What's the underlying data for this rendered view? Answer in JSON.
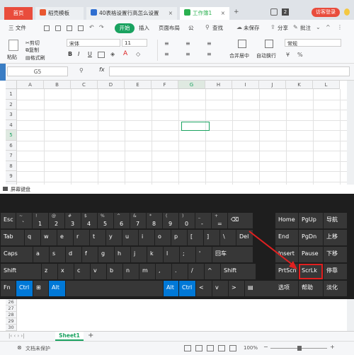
{
  "tabs": {
    "home": "首页",
    "template": "稻壳模板",
    "doc": "40表格设置行高怎么设置",
    "workbook": "工作簿1",
    "badge": "2",
    "login": "访客登录"
  },
  "menubar": {
    "file": "三 文件",
    "start": "开始",
    "insert": "插入",
    "layout": "页面布局",
    "formula": "公",
    "search": "查找",
    "unsaved": "未保存",
    "share": "分享",
    "annotate": "批注"
  },
  "ribbon": {
    "cut": "剪切",
    "copy": "复制",
    "format_painter": "格式刷",
    "paste": "粘贴",
    "font_name": "宋体",
    "font_size": "11",
    "number_format": "常规",
    "merge_center": "合并居中",
    "auto_wrap": "自动换行",
    "bold": "B",
    "italic": "I",
    "underline": "U",
    "font_color": "A"
  },
  "formula_bar": {
    "cell_ref": "G5",
    "fx": "fx",
    "content": ""
  },
  "sheet": {
    "columns": [
      "A",
      "B",
      "C",
      "D",
      "E",
      "F",
      "G",
      "H",
      "I",
      "J",
      "K",
      "L"
    ],
    "rows": [
      "1",
      "2",
      "3",
      "4",
      "5",
      "6",
      "7",
      "8",
      "9",
      "10"
    ],
    "lower_rows": [
      "26",
      "27",
      "28",
      "29",
      "30"
    ],
    "selected_cell": "G5"
  },
  "osk": {
    "title": "屏幕键盘",
    "row1": [
      {
        "label": "Esc"
      },
      {
        "shift": "~",
        "label": "`"
      },
      {
        "shift": "!",
        "label": "1"
      },
      {
        "shift": "@",
        "label": "2"
      },
      {
        "shift": "#",
        "label": "3"
      },
      {
        "shift": "$",
        "label": "4"
      },
      {
        "shift": "%",
        "label": "5"
      },
      {
        "shift": "^",
        "label": "6"
      },
      {
        "shift": "&",
        "label": "7"
      },
      {
        "shift": "*",
        "label": "8"
      },
      {
        "shift": "(",
        "label": "9"
      },
      {
        "shift": ")",
        "label": "0"
      },
      {
        "shift": "_",
        "label": "-"
      },
      {
        "shift": "+",
        "label": "="
      },
      {
        "label": "⌫"
      }
    ],
    "row2": [
      "Tab",
      "q",
      "w",
      "e",
      "r",
      "t",
      "y",
      "u",
      "i",
      "o",
      "p",
      "[",
      "]",
      "\\",
      "Del"
    ],
    "row3": [
      "Caps",
      "a",
      "s",
      "d",
      "f",
      "g",
      "h",
      "j",
      "k",
      "l",
      ";",
      "'",
      "回车"
    ],
    "row4": [
      "Shift",
      "z",
      "x",
      "c",
      "v",
      "b",
      "n",
      "m",
      ",",
      ".",
      "/",
      "^",
      "Shift"
    ],
    "row5": [
      "Fn",
      "Ctrl",
      "⊞",
      "Alt",
      "",
      "Alt",
      "Ctrl",
      "<",
      "v",
      ">",
      "▤"
    ],
    "nav": [
      [
        "Home",
        "PgUp",
        "导航"
      ],
      [
        "End",
        "PgDn",
        "上移"
      ],
      [
        "Insert",
        "Pause",
        "下移"
      ],
      [
        "PrtScn",
        "ScrLk",
        "停靠"
      ],
      [
        "选项",
        "帮助",
        "淡化"
      ]
    ],
    "highlight_key": "ScrLk",
    "highlight_color": "#e02020"
  },
  "bottom": {
    "sheet_tab": "Sheet1",
    "add": "+",
    "doc_protect": "文档未保护",
    "zoom": "100%"
  },
  "colors": {
    "accent_green": "#1aa260",
    "active_tab_green": "#2bb150",
    "osk_bg": "#1e1e1e",
    "key_bg": "#373737",
    "key_blue": "#0078d7"
  }
}
